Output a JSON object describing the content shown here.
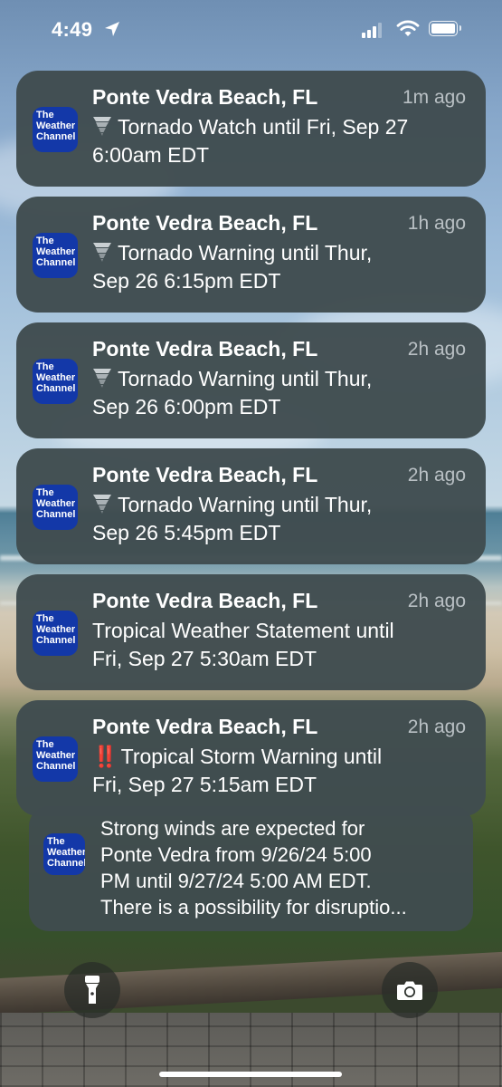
{
  "status_bar": {
    "time": "4:49"
  },
  "app": {
    "icon_text": [
      "The",
      "Weather",
      "Channel"
    ],
    "brand_color": "#1338a8"
  },
  "notifications": [
    {
      "title": "Ponte Vedra Beach, FL",
      "time": "1m ago",
      "icon": "tornado-icon",
      "body": "Tornado Watch until Fri, Sep 27\n6:00am EDT"
    },
    {
      "title": "Ponte Vedra Beach, FL",
      "time": "1h ago",
      "icon": "tornado-icon",
      "body": "Tornado Warning until Thur,\nSep 26 6:15pm EDT"
    },
    {
      "title": "Ponte Vedra Beach, FL",
      "time": "2h ago",
      "icon": "tornado-icon",
      "body": "Tornado Warning until Thur,\nSep 26 6:00pm EDT"
    },
    {
      "title": "Ponte Vedra Beach, FL",
      "time": "2h ago",
      "icon": "tornado-icon",
      "body": "Tornado Warning until Thur,\nSep 26 5:45pm EDT"
    },
    {
      "title": "Ponte Vedra Beach, FL",
      "time": "2h ago",
      "icon": "",
      "body": "Tropical Weather Statement until\nFri, Sep 27 5:30am EDT"
    },
    {
      "title": "Ponte Vedra Beach, FL",
      "time": "2h ago",
      "icon": "double-exclamation-icon",
      "alert_mark": "‼️",
      "body": "Tropical Storm Warning until\nFri, Sep 27 5:15am EDT"
    }
  ],
  "stacked_notification": {
    "lines": [
      "Strong winds are expected for",
      "Ponte Vedra from 9/26/24 5:00",
      "PM until 9/27/24 5:00 AM EDT.",
      "There is a possibility for disruptio..."
    ]
  },
  "lock_screen_buttons": {
    "left_icon": "flashlight-icon",
    "right_icon": "camera-icon"
  }
}
